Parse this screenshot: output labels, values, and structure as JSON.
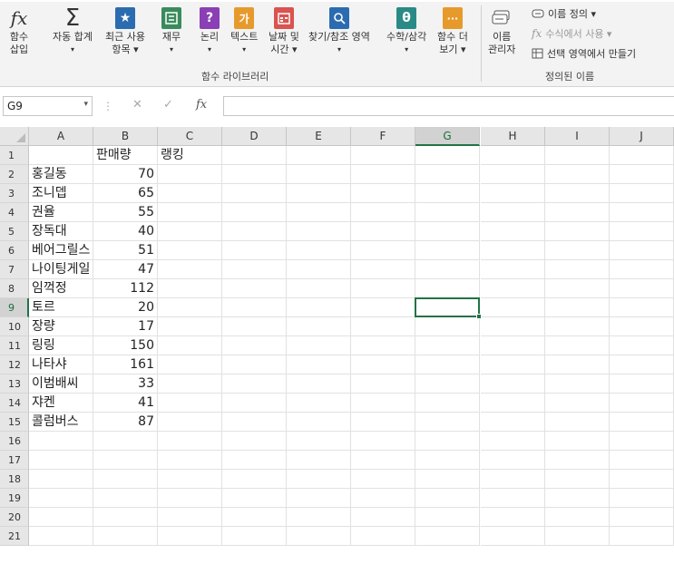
{
  "ribbon": {
    "insert_function": {
      "line1": "함수",
      "line2": "삽입"
    },
    "autosum": {
      "line1": "자동 합계",
      "line2": "▾"
    },
    "recent": {
      "line1": "최근 사용",
      "line2": "항목 ▾"
    },
    "financial": {
      "line1": "재무",
      "line2": "▾"
    },
    "logical": {
      "line1": "논리",
      "line2": "▾"
    },
    "text": {
      "line1": "텍스트",
      "line2": "▾",
      "icon": "가"
    },
    "datetime": {
      "line1": "날짜 및",
      "line2": "시간 ▾"
    },
    "lookup": {
      "line1": "찾기/참조 영역",
      "line2": "▾"
    },
    "math": {
      "line1": "수학/삼각",
      "line2": "▾",
      "icon": "θ"
    },
    "more": {
      "line1": "함수 더",
      "line2": "보기 ▾",
      "icon": "···"
    },
    "library_group": "함수 라이브러리",
    "name_manager": {
      "line1": "이름",
      "line2": "관리자"
    },
    "define_name": "이름 정의 ▾",
    "use_in_formula": "수식에서 사용 ▾",
    "create_from_selection": "선택 영역에서 만들기",
    "names_group": "정의된 이름",
    "icon_fx": "fx",
    "icon_sigma": "Σ",
    "icon_logical": "?",
    "colors": {
      "blue": "#2b6cb0",
      "green": "#3a8b5c",
      "purple": "#8a3fb5",
      "orange": "#e79a2c",
      "red": "#d9534f",
      "teal": "#2a8a85"
    }
  },
  "formula_bar": {
    "name_box": "G9",
    "name_box_arrow": "▾",
    "dots": "⋮",
    "cancel": "✕",
    "confirm": "✓",
    "fx": "fx",
    "formula": ""
  },
  "sheet": {
    "columns": [
      "A",
      "B",
      "C",
      "D",
      "E",
      "F",
      "G",
      "H",
      "I",
      "J"
    ],
    "rows": [
      "1",
      "2",
      "3",
      "4",
      "5",
      "6",
      "7",
      "8",
      "9",
      "10",
      "11",
      "12",
      "13",
      "14",
      "15",
      "16",
      "17",
      "18",
      "19",
      "20",
      "21"
    ],
    "selected_cell": "G9",
    "header": {
      "b": "판매량",
      "c": "랭킹"
    },
    "data": [
      {
        "name": "홍길동",
        "sales": "70"
      },
      {
        "name": "조니뎁",
        "sales": "65"
      },
      {
        "name": "권율",
        "sales": "55"
      },
      {
        "name": "장독대",
        "sales": "40"
      },
      {
        "name": "베어그릴스",
        "sales": "51"
      },
      {
        "name": "나이팅게일",
        "sales": "47"
      },
      {
        "name": "임꺽정",
        "sales": "112"
      },
      {
        "name": "토르",
        "sales": "20"
      },
      {
        "name": "장량",
        "sales": "17"
      },
      {
        "name": "링링",
        "sales": "150"
      },
      {
        "name": "나타샤",
        "sales": "161"
      },
      {
        "name": "이범배씨",
        "sales": "33"
      },
      {
        "name": "쟈켄",
        "sales": "41"
      },
      {
        "name": "콜럼버스",
        "sales": "87"
      }
    ]
  }
}
